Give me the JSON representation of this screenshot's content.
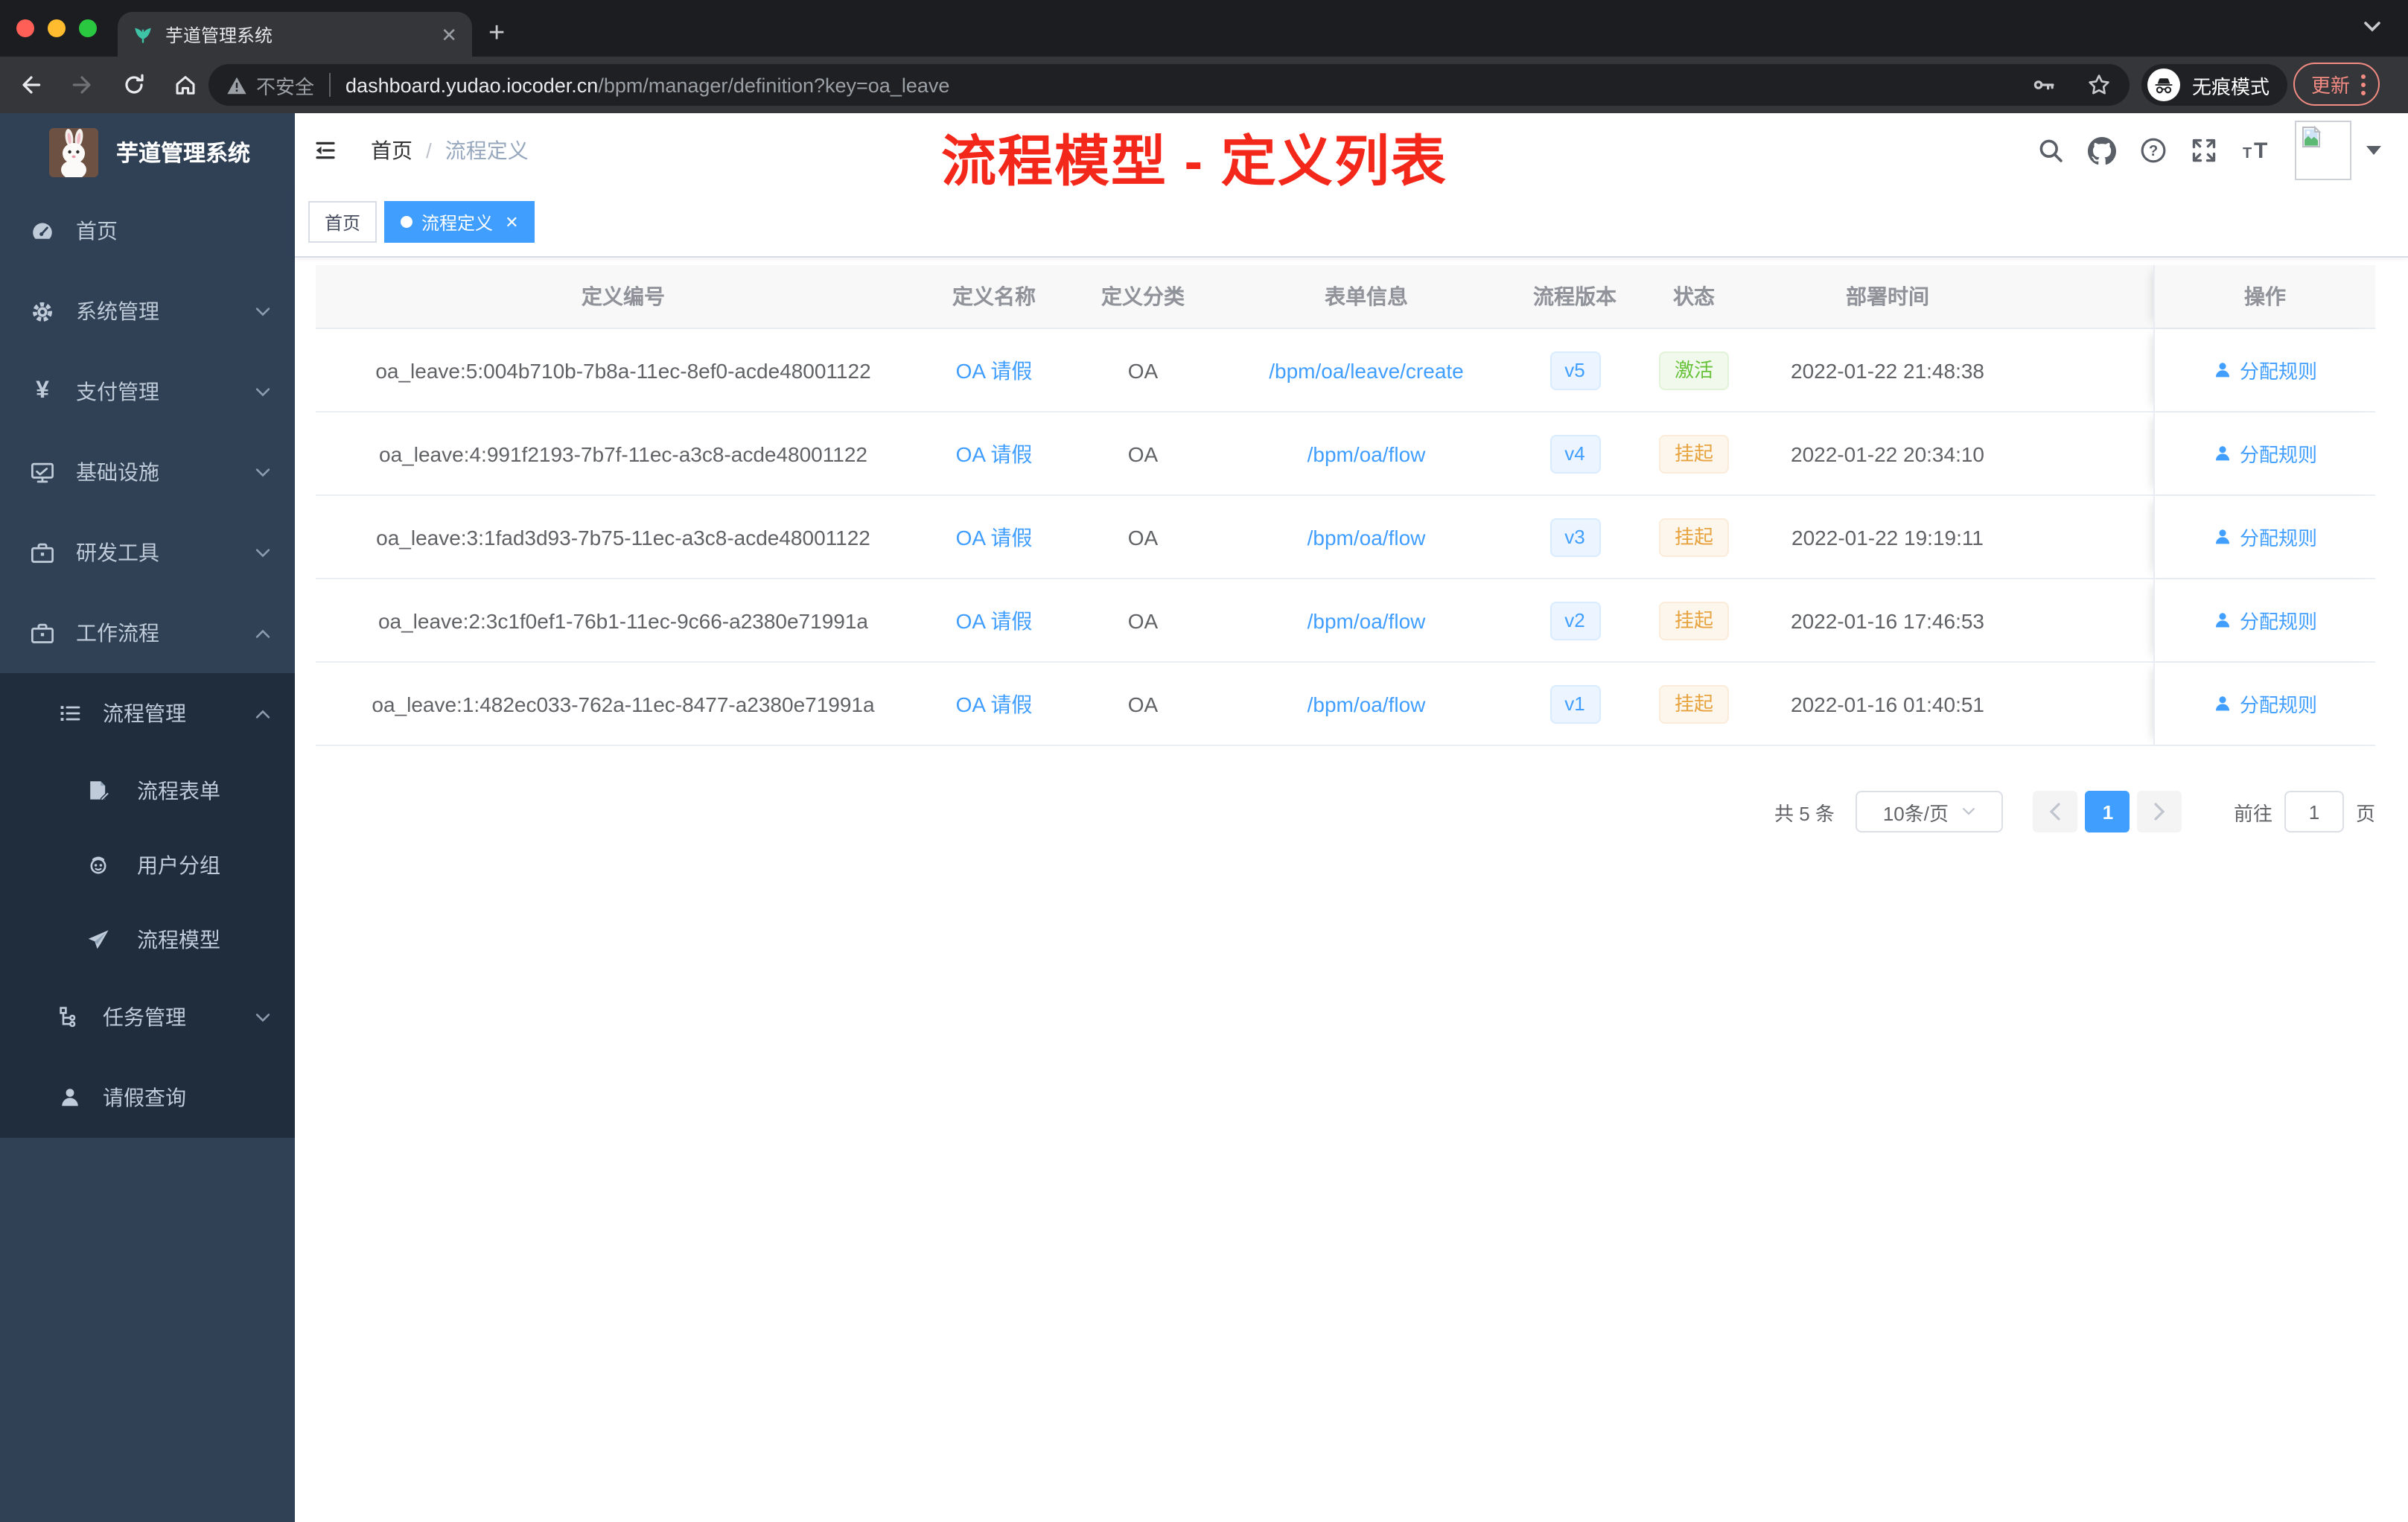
{
  "colors": {
    "accent_blue": "#409eff",
    "status_active_green": "#67c23a",
    "status_suspended_orange": "#e6a23c",
    "annotation_red": "#f4271b",
    "sidebar_bg": "#304156",
    "sidebar_submenu_bg": "#1f2d3d",
    "update_button_red": "#f28b82"
  },
  "browser": {
    "tab_title": "芋道管理系统",
    "not_secure": "不安全",
    "url_host": "dashboard.yudao.iocoder.cn",
    "url_path": "/bpm/manager/definition?key=oa_leave",
    "incognito_label": "无痕模式",
    "update_label": "更新"
  },
  "sidebar": {
    "title": "芋道管理系统",
    "items": [
      {
        "label": "首页",
        "icon": "dashboard-icon"
      },
      {
        "label": "系统管理",
        "icon": "gear-icon"
      },
      {
        "label": "支付管理",
        "icon": "yen-icon"
      },
      {
        "label": "基础设施",
        "icon": "monitor-icon"
      },
      {
        "label": "研发工具",
        "icon": "toolbox-icon"
      },
      {
        "label": "工作流程",
        "icon": "briefcase-icon"
      }
    ],
    "workflow_items": [
      {
        "label": "流程管理",
        "icon": "list-icon"
      },
      {
        "label": "流程表单",
        "icon": "form-icon"
      },
      {
        "label": "用户分组",
        "icon": "group-icon"
      },
      {
        "label": "流程模型",
        "icon": "paper-plane-icon"
      },
      {
        "label": "任务管理",
        "icon": "tree-icon"
      },
      {
        "label": "请假查询",
        "icon": "user-icon"
      }
    ]
  },
  "header": {
    "breadcrumb_home": "首页",
    "breadcrumb_current": "流程定义",
    "annotation": "流程模型 - 定义列表"
  },
  "tags": {
    "home": "首页",
    "active": "流程定义"
  },
  "table": {
    "columns": [
      "定义编号",
      "定义名称",
      "定义分类",
      "表单信息",
      "流程版本",
      "状态",
      "部署时间",
      "操作"
    ],
    "action_label": "分配规则",
    "rows": [
      {
        "id": "oa_leave:5:004b710b-7b8a-11ec-8ef0-acde48001122",
        "name": "OA 请假",
        "category": "OA",
        "form": "/bpm/oa/leave/create",
        "version": "v5",
        "status": "激活",
        "time": "2022-01-22 21:48:38"
      },
      {
        "id": "oa_leave:4:991f2193-7b7f-11ec-a3c8-acde48001122",
        "name": "OA 请假",
        "category": "OA",
        "form": "/bpm/oa/flow",
        "version": "v4",
        "status": "挂起",
        "time": "2022-01-22 20:34:10"
      },
      {
        "id": "oa_leave:3:1fad3d93-7b75-11ec-a3c8-acde48001122",
        "name": "OA 请假",
        "category": "OA",
        "form": "/bpm/oa/flow",
        "version": "v3",
        "status": "挂起",
        "time": "2022-01-22 19:19:11"
      },
      {
        "id": "oa_leave:2:3c1f0ef1-76b1-11ec-9c66-a2380e71991a",
        "name": "OA 请假",
        "category": "OA",
        "form": "/bpm/oa/flow",
        "version": "v2",
        "status": "挂起",
        "time": "2022-01-16 17:46:53"
      },
      {
        "id": "oa_leave:1:482ec033-762a-11ec-8477-a2380e71991a",
        "name": "OA 请假",
        "category": "OA",
        "form": "/bpm/oa/flow",
        "version": "v1",
        "status": "挂起",
        "time": "2022-01-16 01:40:51"
      }
    ]
  },
  "pagination": {
    "total": "共 5 条",
    "page_size": "10条/页",
    "current": "1",
    "goto_label": "前往",
    "goto_value": "1",
    "page_suffix": "页"
  }
}
